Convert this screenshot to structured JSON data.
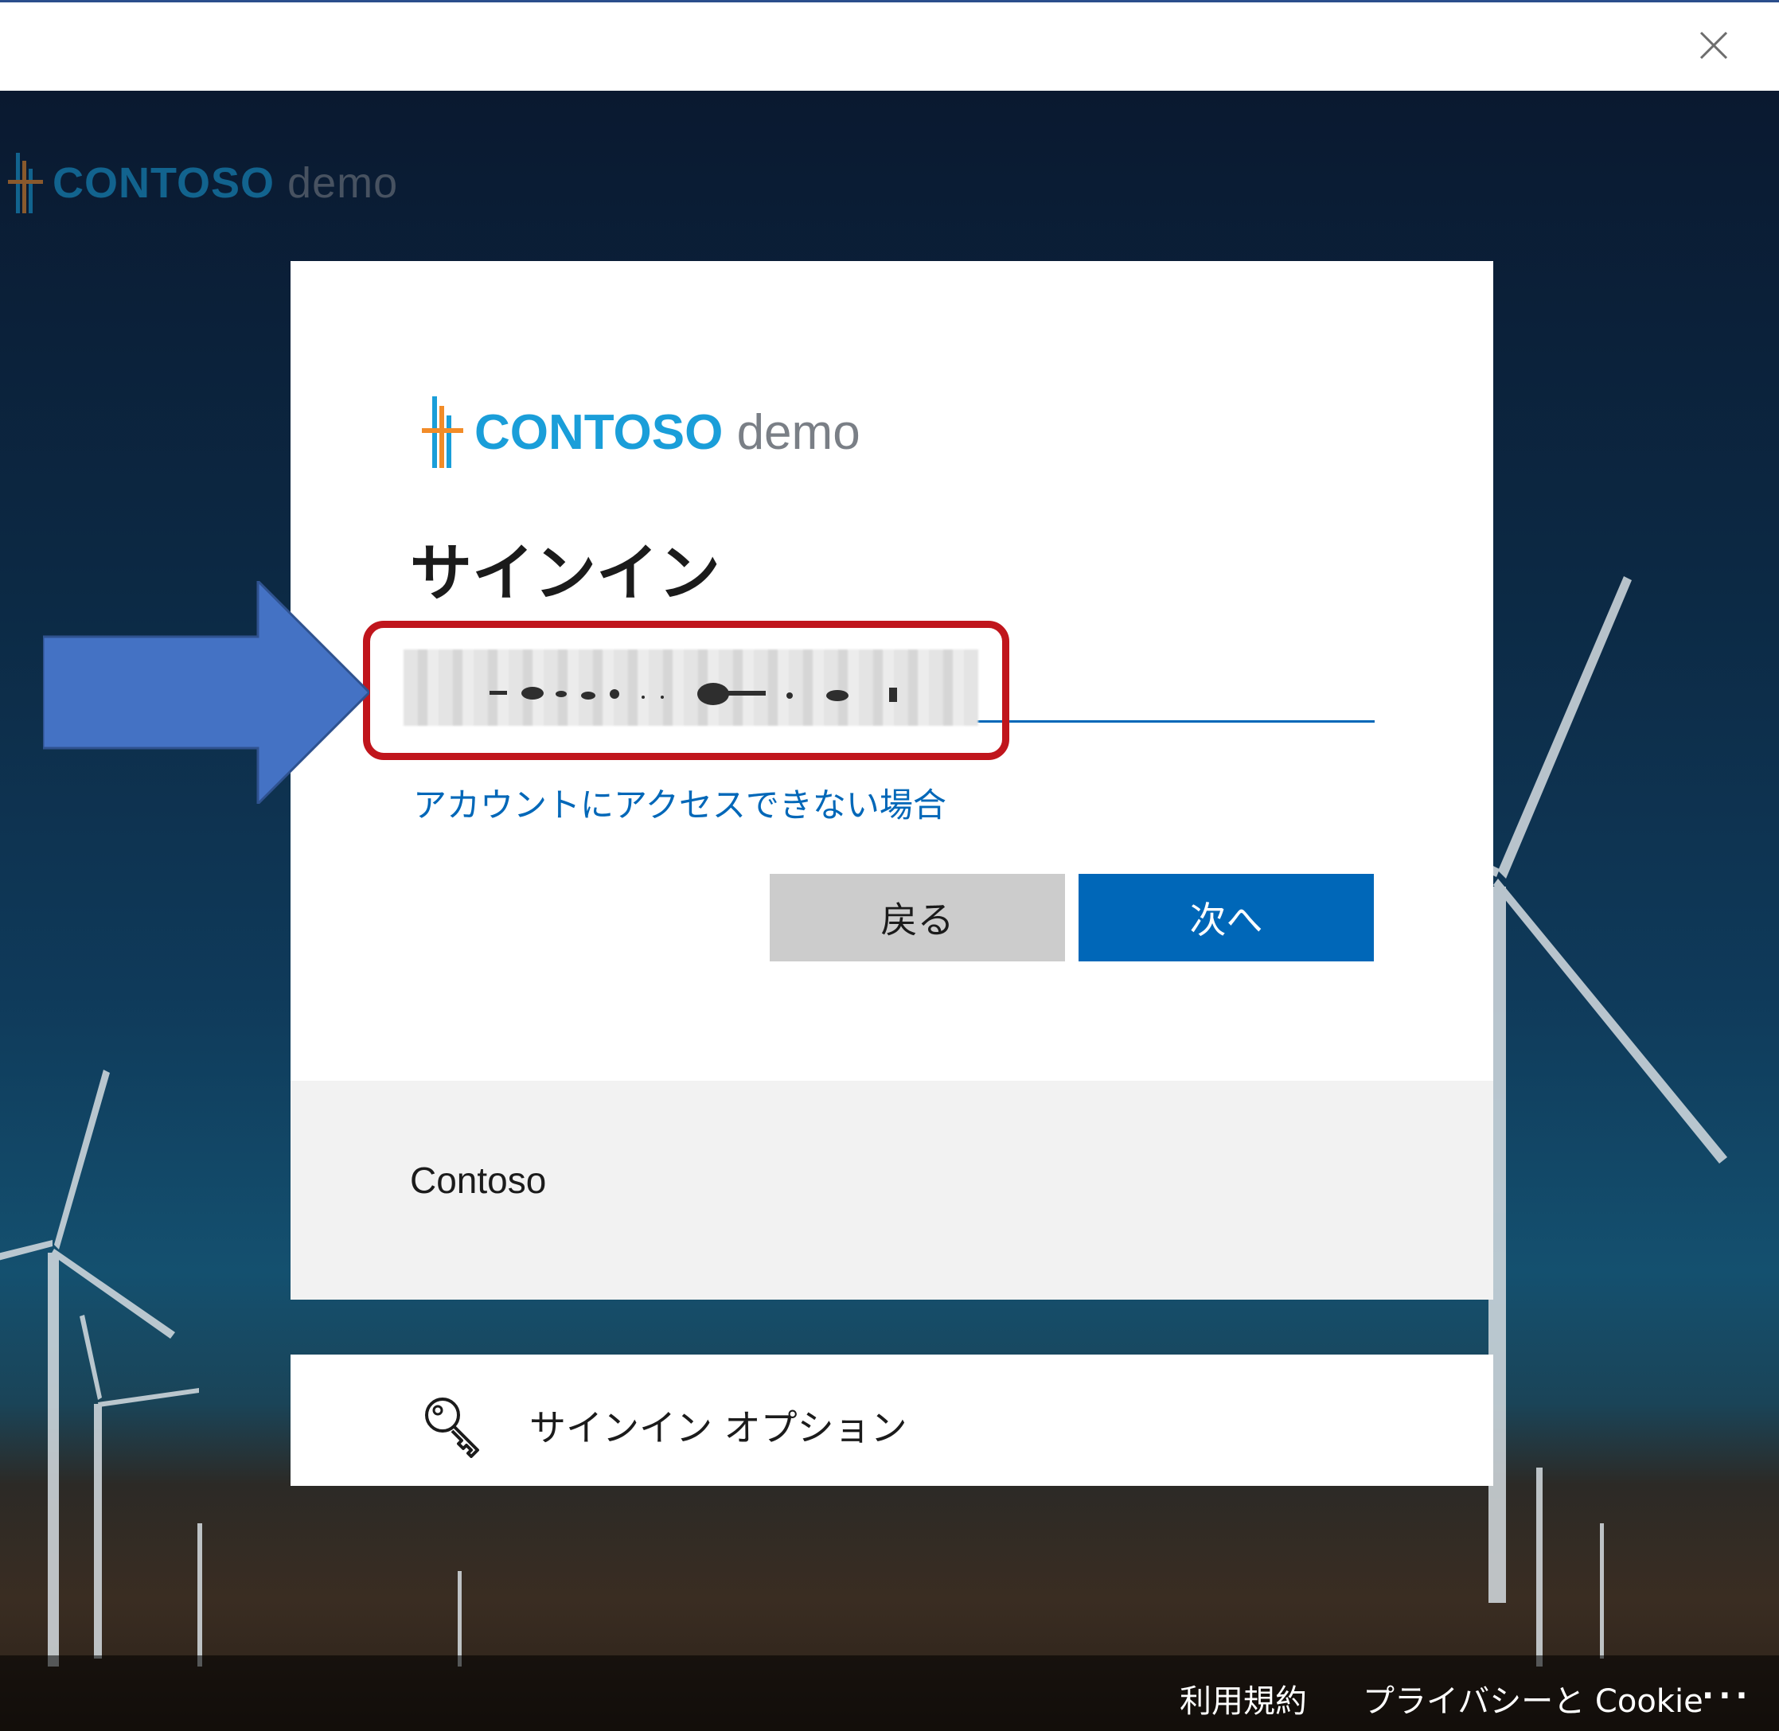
{
  "window": {
    "close_icon": "close-icon"
  },
  "brand": {
    "name_part1": "CONTOSO",
    "name_part2": "demo"
  },
  "signin": {
    "title": "サインイン",
    "email_value": "",
    "cant_access_link": "アカウントにアクセスできない場合",
    "back_button": "戻る",
    "next_button": "次へ"
  },
  "tenant": {
    "name": "Contoso"
  },
  "options": {
    "label": "サインイン オプション",
    "icon": "key-icon"
  },
  "footer": {
    "terms": "利用規約",
    "privacy": "プライバシーと Cookie",
    "more": "..."
  },
  "colors": {
    "accent": "#0067b8",
    "annotation_red": "#c0151c",
    "annotation_arrow": "#4472c4"
  }
}
